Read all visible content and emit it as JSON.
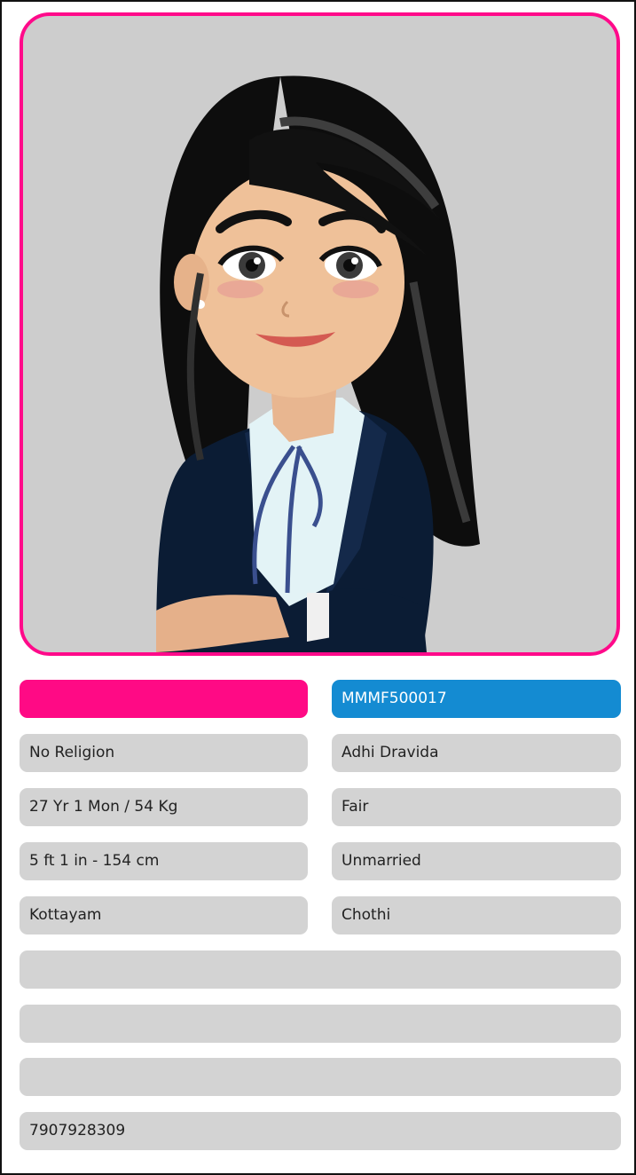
{
  "profile": {
    "avatar_icon": "woman-avatar-icon",
    "name": "",
    "id": "MMMF500017",
    "religion": "No Religion",
    "caste": "Adhi Dravida",
    "age_weight": "27 Yr 1 Mon / 54 Kg",
    "complexion": "Fair",
    "height": "5 ft 1 in - 154 cm",
    "marital_status": "Unmarried",
    "location": "Kottayam",
    "star": "Chothi",
    "extra_1": "",
    "extra_2": "",
    "extra_3": "",
    "phone": "7907928309"
  },
  "colors": {
    "accent_pink": "#ff0a85",
    "accent_blue": "#148bd2",
    "field_bg": "#d3d3d3",
    "photo_bg": "#cdcdcd"
  }
}
